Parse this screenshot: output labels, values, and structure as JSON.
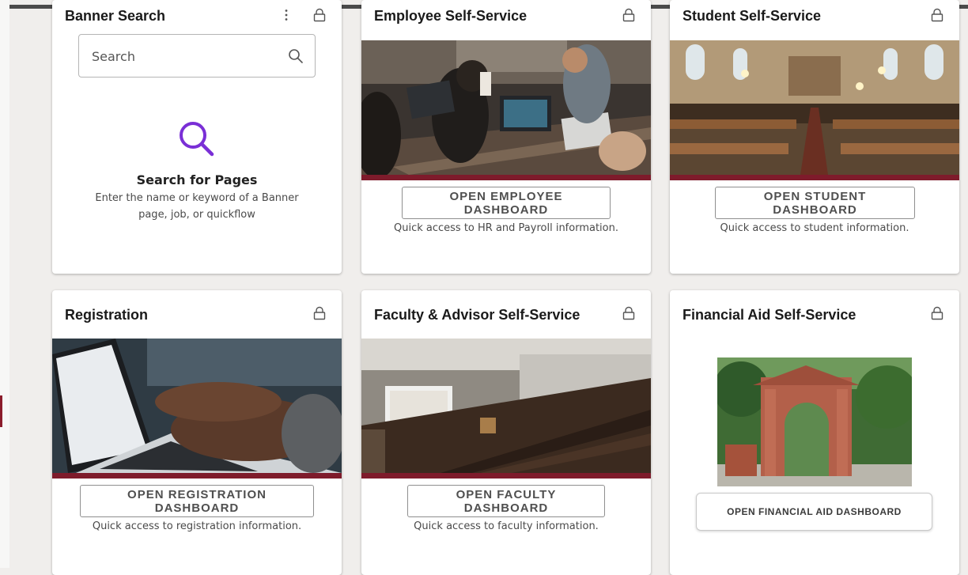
{
  "colors": {
    "accent_maroon": "#7e1b2b",
    "search_purple": "#7a2fd6",
    "background": "#f0eeec"
  },
  "banner_search": {
    "title": "Banner Search",
    "search_placeholder": "Search",
    "heading": "Search for Pages",
    "help_line1": "Enter the name or keyword of a Banner",
    "help_line2": "page, job, or quickflow",
    "icons": [
      "kebab-menu-icon",
      "lock-icon",
      "search-icon",
      "magnifier-icon"
    ]
  },
  "employee": {
    "title": "Employee Self-Service",
    "button": "OPEN EMPLOYEE DASHBOARD",
    "description": "Quick access to HR and Payroll information."
  },
  "student": {
    "title": "Student Self-Service",
    "button": "OPEN STUDENT DASHBOARD",
    "description": "Quick access to student information."
  },
  "registration": {
    "title": "Registration",
    "button": "OPEN REGISTRATION DASHBOARD",
    "description": "Quick access to registration information."
  },
  "faculty": {
    "title": "Faculty & Advisor Self-Service",
    "button": "OPEN FACULTY DASHBOARD",
    "description": "Quick access to faculty information."
  },
  "financial_aid": {
    "title": "Financial Aid Self-Service",
    "button": "OPEN FINANCIAL AID DASHBOARD"
  }
}
